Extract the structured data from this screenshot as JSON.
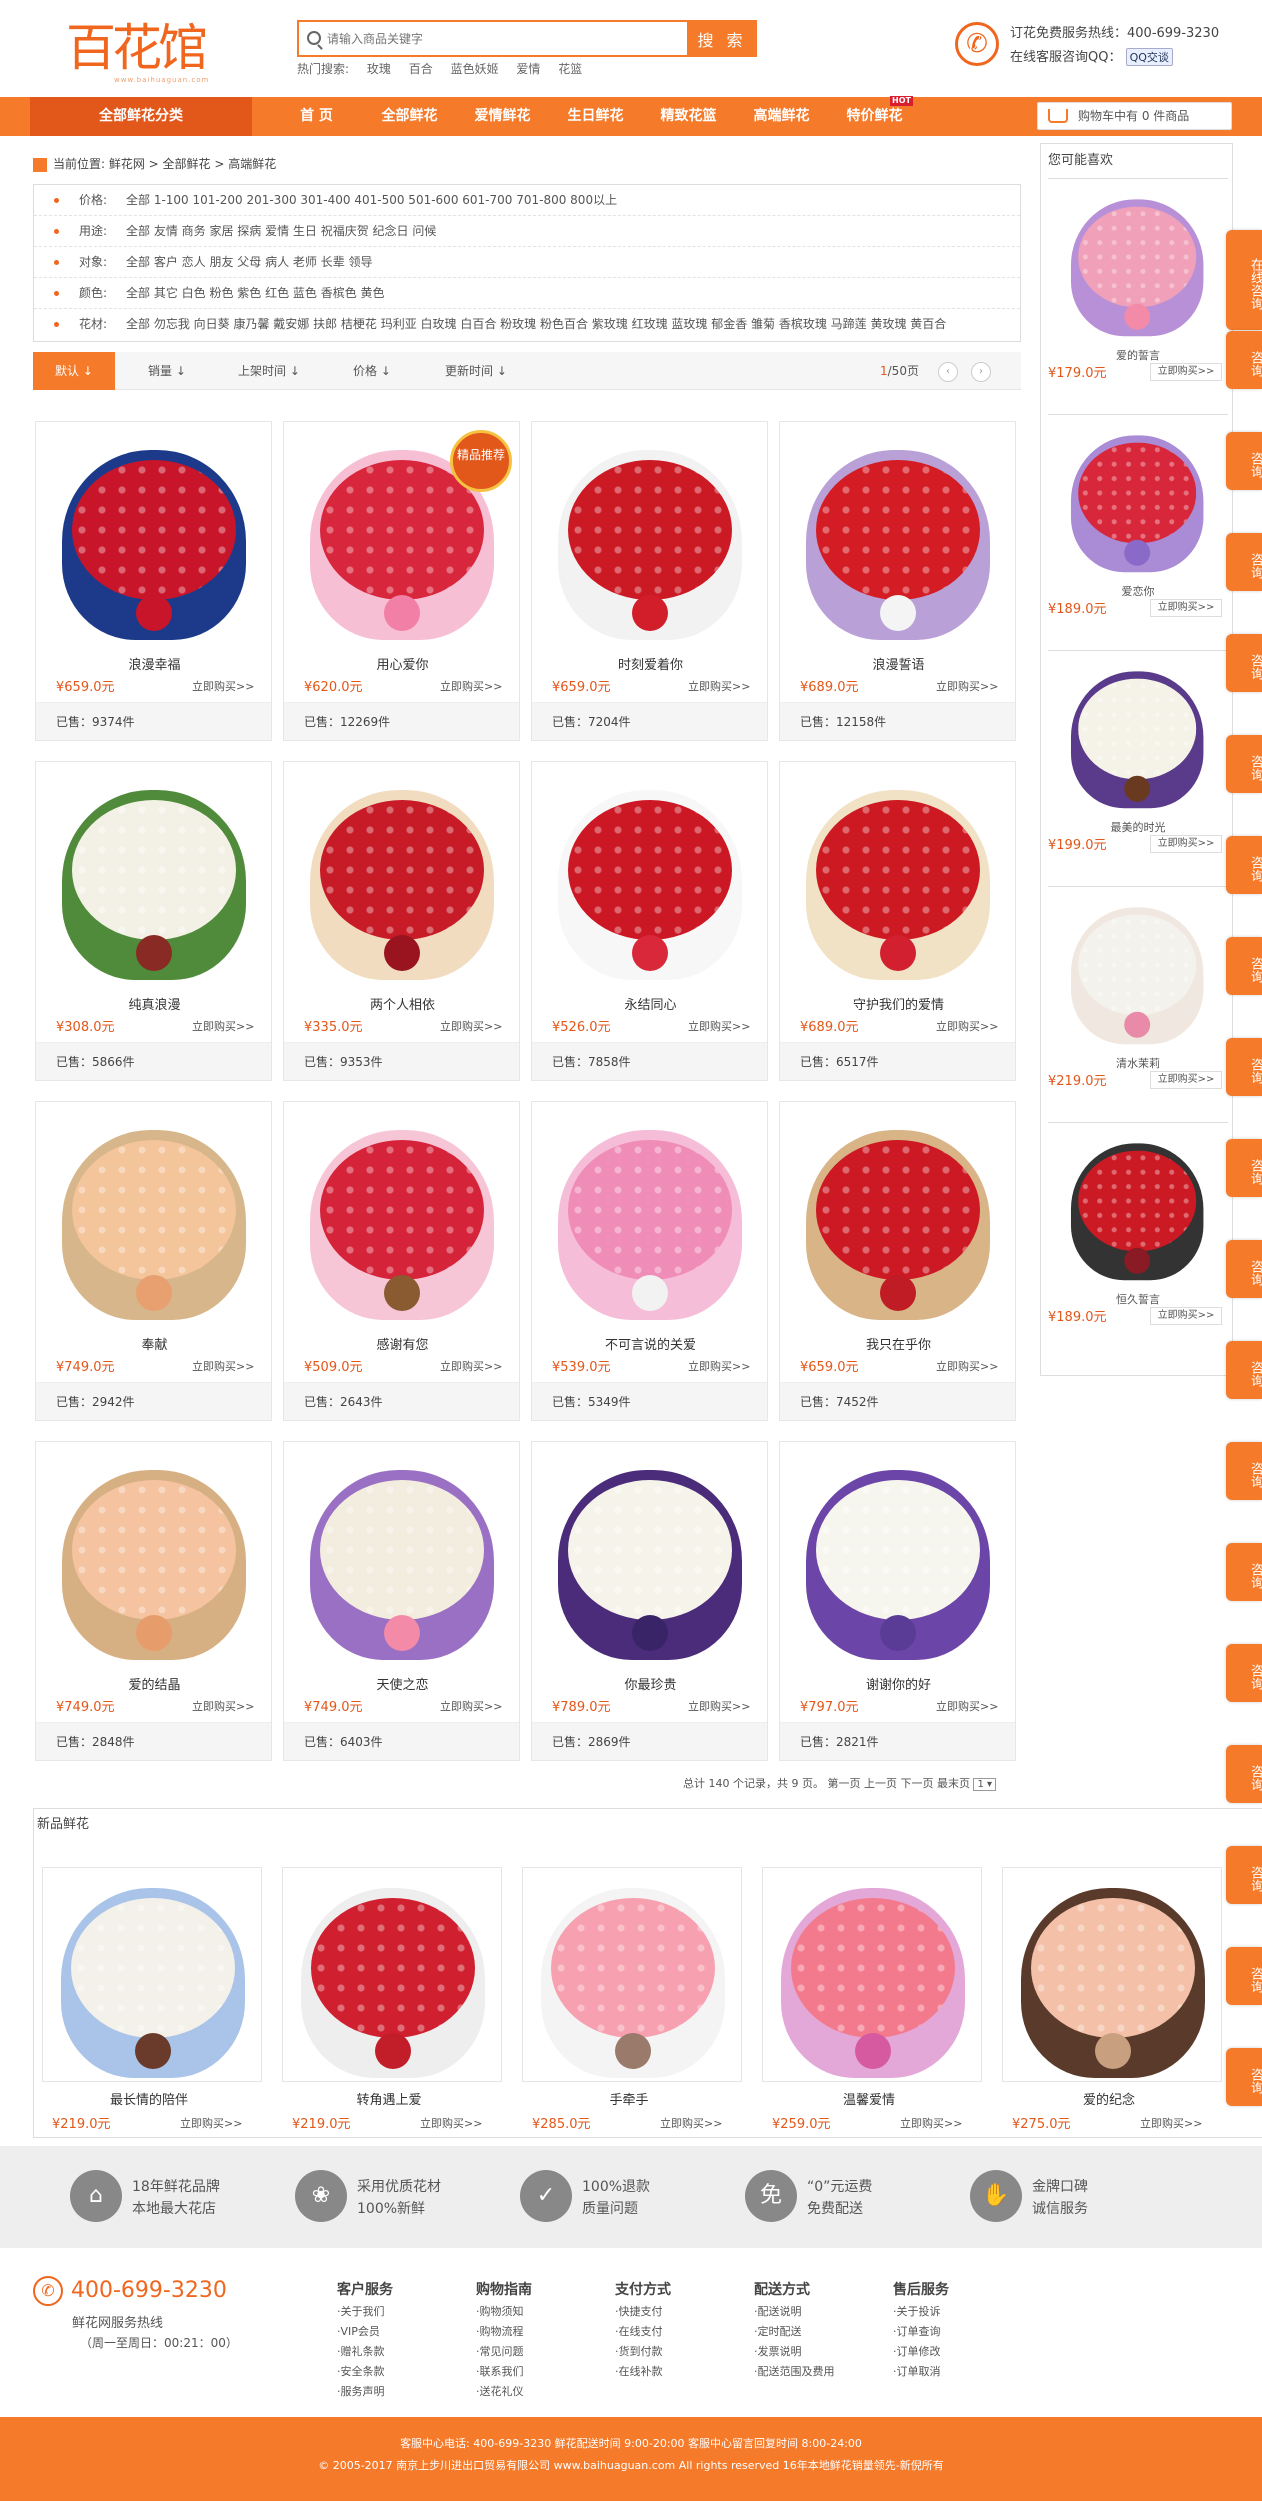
{
  "logo": {
    "text": "百花馆",
    "sub": "www.baihuaguan.com"
  },
  "search": {
    "placeholder": "请输入商品关键字",
    "button": "搜 索"
  },
  "hot_searches": {
    "label": "热门搜索:",
    "items": [
      "玫瑰",
      "百合",
      "蓝色妖姬",
      "爱情",
      "花篮"
    ]
  },
  "contact": {
    "hotline": "订花免费服务热线：400-699-3230",
    "qq_label": "在线客服咨询QQ：",
    "qq_button": "QQ交谈"
  },
  "nav": {
    "category": "全部鲜花分类",
    "items": [
      "首 页",
      "全部鲜花",
      "爱情鲜花",
      "生日鲜花",
      "精致花篮",
      "高端鲜花",
      "特价鲜花"
    ],
    "hot_badge": "HOT"
  },
  "cart": {
    "text": "购物车中有 0 件商品"
  },
  "breadcrumb": "当前位置: 鲜花网 > 全部鲜花 > 高端鲜花",
  "filters": [
    {
      "label": "价格:",
      "values": "全部 1-100 101-200 201-300 301-400 401-500 501-600 601-700 701-800 800以上"
    },
    {
      "label": "用途:",
      "values": "全部 友情 商务 家居 探病 爱情 生日 祝福庆贺 纪念日 问候"
    },
    {
      "label": "对象:",
      "values": "全部 客户 恋人 朋友 父母 病人 老师 长辈 领导"
    },
    {
      "label": "颜色:",
      "values": "全部 其它 白色 粉色 紫色 红色 蓝色 香槟色 黄色"
    },
    {
      "label": "花材:",
      "values": "全部 勿忘我 向日葵 康乃馨 戴安娜 扶郎 桔梗花 玛利亚 白玫瑰 白百合 粉玫瑰 粉色百合 紫玫瑰 红玫瑰 蓝玫瑰 郁金香 雏菊 香槟玫瑰 马蹄莲 黄玫瑰 黄百合"
    }
  ],
  "sort": {
    "items": [
      "默认",
      "销量",
      "上架时间",
      "价格",
      "更新时间"
    ],
    "page": "1",
    "pages": "/50页"
  },
  "products": [
    {
      "name": "浪漫幸福",
      "price": "¥659.0元",
      "buy": "立即购买>>",
      "sold": "已售：9374件",
      "fc": "#c8152a",
      "pc": "#1d3a8a",
      "bc": "#c8152a"
    },
    {
      "name": "用心爱你",
      "price": "¥620.0元",
      "buy": "立即购买>>",
      "sold": "已售：12269件",
      "fc": "#d8263c",
      "pc": "#f6bfd4",
      "bc": "#f27fa6",
      "badge": "精品推荐"
    },
    {
      "name": "时刻爱着你",
      "price": "¥659.0元",
      "buy": "立即购买>>",
      "sold": "已售：7204件",
      "fc": "#cc1a25",
      "pc": "#f2f2f2",
      "bc": "#d21e2b"
    },
    {
      "name": "浪漫誓语",
      "price": "¥689.0元",
      "buy": "立即购买>>",
      "sold": "已售：12158件",
      "fc": "#d41c24",
      "pc": "#b9a0d6",
      "bc": "#f4f4f4"
    },
    {
      "name": "纯真浪漫",
      "price": "¥308.0元",
      "buy": "立即购买>>",
      "sold": "已售：5866件",
      "fc": "#f3f1e6",
      "pc": "#4f8b3a",
      "bc": "#8a2a24"
    },
    {
      "name": "两个人相依",
      "price": "¥335.0元",
      "buy": "立即购买>>",
      "sold": "已售：9353件",
      "fc": "#c71b27",
      "pc": "#f1dcc0",
      "bc": "#9a1420"
    },
    {
      "name": "永结同心",
      "price": "¥526.0元",
      "buy": "立即购买>>",
      "sold": "已售：7858件",
      "fc": "#cc1724",
      "pc": "#f7f7f7",
      "bc": "#d8283a"
    },
    {
      "name": "守护我们的爱情",
      "price": "¥689.0元",
      "buy": "立即购买>>",
      "sold": "已售：6517件",
      "fc": "#cd1a22",
      "pc": "#f1e2c6",
      "bc": "#d22030"
    },
    {
      "name": "奉献",
      "price": "¥749.0元",
      "buy": "立即购买>>",
      "sold": "已售：2942件",
      "fc": "#f4c49a",
      "pc": "#d6b68a",
      "bc": "#e8a070"
    },
    {
      "name": "感谢有您",
      "price": "¥509.0元",
      "buy": "立即购买>>",
      "sold": "已售：2643件",
      "fc": "#d5243a",
      "pc": "#f7c6d6",
      "bc": "#8a5a30"
    },
    {
      "name": "不可言说的关爱",
      "price": "¥539.0元",
      "buy": "立即购买>>",
      "sold": "已售：5349件",
      "fc": "#f08cb8",
      "pc": "#f6bdd8",
      "bc": "#f2f2f2"
    },
    {
      "name": "我只在乎你",
      "price": "¥659.0元",
      "buy": "立即购买>>",
      "sold": "已售：7452件",
      "fc": "#cc1923",
      "pc": "#d8b487",
      "bc": "#c01c25"
    },
    {
      "name": "爱的结晶",
      "price": "¥749.0元",
      "buy": "立即购买>>",
      "sold": "已售：2848件",
      "fc": "#f5c3a0",
      "pc": "#d6b082",
      "bc": "#e79d6b"
    },
    {
      "name": "天使之恋",
      "price": "¥749.0元",
      "buy": "立即购买>>",
      "sold": "已售：6403件",
      "fc": "#f3ede0",
      "pc": "#9a70c4",
      "bc": "#f28aa8"
    },
    {
      "name": "你最珍贵",
      "price": "¥789.0元",
      "buy": "立即购买>>",
      "sold": "已售：2869件",
      "fc": "#f6f4ea",
      "pc": "#4a2c7a",
      "bc": "#3a2468"
    },
    {
      "name": "谢谢你的好",
      "price": "¥797.0元",
      "buy": "立即购买>>",
      "sold": "已售：2821件",
      "fc": "#f7f6ee",
      "pc": "#6b46a8",
      "bc": "#5a3c96"
    }
  ],
  "pager": {
    "text": "总计 140 个记录，共 9 页。 第一页 上一页 下一页 最末页",
    "select": "1 ▾"
  },
  "sidebar": {
    "title": "您可能喜欢",
    "items": [
      {
        "name": "爱的誓言",
        "price": "¥179.0元",
        "buy": "立即购买>>",
        "fc": "#f0a0b8",
        "pc": "#b890d8",
        "bc": "#f28aa8"
      },
      {
        "name": "爱恋你",
        "price": "¥189.0元",
        "buy": "立即购买>>",
        "fc": "#d8263a",
        "pc": "#a98bd6",
        "bc": "#8a6ac8"
      },
      {
        "name": "最美的时光",
        "price": "¥199.0元",
        "buy": "立即购买>>",
        "fc": "#f5f2e8",
        "pc": "#5a3a8a",
        "bc": "#6a3a20"
      },
      {
        "name": "清水茉莉",
        "price": "¥219.0元",
        "buy": "立即购买>>",
        "fc": "#f4f2ec",
        "pc": "#f0e8e0",
        "bc": "#e88aa8"
      },
      {
        "name": "恒久誓言",
        "price": "¥189.0元",
        "buy": "立即购买>>",
        "fc": "#cc1a25",
        "pc": "#333333",
        "bc": "#8a1a24"
      }
    ]
  },
  "float_tab": [
    "在线咨询",
    "咨询"
  ],
  "new_section": {
    "title": "新品鲜花",
    "items": [
      {
        "name": "最长情的陪伴",
        "price": "¥219.0元",
        "buy": "立即购买>>",
        "fc": "#f3f1ea",
        "pc": "#a9c4e8",
        "bc": "#6a3a2a"
      },
      {
        "name": "转角遇上爱",
        "price": "¥219.0元",
        "buy": "立即购买>>",
        "fc": "#d02030",
        "pc": "#eeeeee",
        "bc": "#c21e2a"
      },
      {
        "name": "手牵手",
        "price": "¥285.0元",
        "buy": "立即购买>>",
        "fc": "#f7a0b0",
        "pc": "#f4f4f4",
        "bc": "#9a7a6a"
      },
      {
        "name": "温馨爱情",
        "price": "¥259.0元",
        "buy": "立即购买>>",
        "fc": "#f27a8c",
        "pc": "#e4a8d8",
        "bc": "#d65aa0"
      },
      {
        "name": "爱的纪念",
        "price": "¥275.0元",
        "buy": "立即购买>>",
        "fc": "#f4c0a8",
        "pc": "#5a3a2a",
        "bc": "#c8a080"
      }
    ]
  },
  "promises": [
    {
      "icon": "⌂",
      "line1": "18年鲜花品牌",
      "line2": "本地最大花店"
    },
    {
      "icon": "❀",
      "line1": "采用优质花材",
      "line2": "100%新鲜"
    },
    {
      "icon": "✓",
      "line1": "100%退款",
      "line2": "质量问题"
    },
    {
      "icon": "免",
      "line1": "“0”元运费",
      "line2": "免费配送"
    },
    {
      "icon": "✋",
      "line1": "金牌口碑",
      "line2": "诚信服务"
    }
  ],
  "footer": {
    "phone": "400-699-3230",
    "phone_label": "鲜花网服务热线",
    "hours": "（周一至周日：00:21：00）",
    "cols": [
      {
        "title": "客户服务",
        "links": [
          "·关于我们",
          "·VIP会员",
          "·赠礼条款",
          "·安全条款",
          "·服务声明"
        ]
      },
      {
        "title": "购物指南",
        "links": [
          "·购物须知",
          "·购物流程",
          "·常见问题",
          "·联系我们",
          "·送花礼仪"
        ]
      },
      {
        "title": "支付方式",
        "links": [
          "·快捷支付",
          "·在线支付",
          "·货到付款",
          "·在线补款"
        ]
      },
      {
        "title": "配送方式",
        "links": [
          "·配送说明",
          "·定时配送",
          "·发票说明",
          "·配送范围及费用"
        ]
      },
      {
        "title": "售后服务",
        "links": [
          "·关于投诉",
          "·订单查询",
          "·订单修改",
          "·订单取消"
        ]
      }
    ],
    "line1": "客服中心电话: 400-699-3230 鲜花配送时间 9:00-20:00 客服中心留言回复时间 8:00-24:00",
    "line2": "© 2005-2017 南京上步川进出口贸易有限公司 www.baihuaguan.com All rights reserved 16年本地鲜花销量领先-新倪所有"
  },
  "colors": {
    "accent": "#f57a2a",
    "accent_dark": "#e2571a",
    "price": "#e2571a"
  }
}
